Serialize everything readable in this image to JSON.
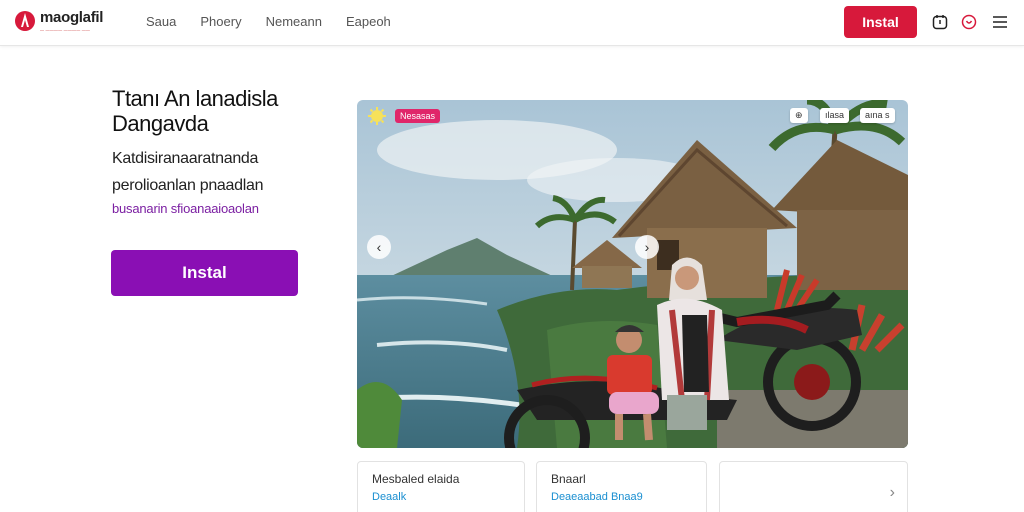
{
  "header": {
    "logo_text": "maoglafil",
    "logo_sub": "— ———— ———— ——",
    "nav": [
      "Saua",
      "Phoery",
      "Nemeann",
      "Eapeoh"
    ],
    "install_label": "Instal"
  },
  "hero": {
    "title": "Ttanı An lanadisla Dangavda",
    "body": "Katdisiranaaratnanda perolioanlan pnaadlan",
    "link": "busanarin sfioanaaioaolan",
    "cta_label": "Instal"
  },
  "carousel": {
    "tag": "Nesasas",
    "chips": [
      "⊕",
      "ılasa",
      "aına s"
    ],
    "prev": "‹",
    "next": "›"
  },
  "cards": [
    {
      "title": "Mesbaled elaida",
      "link": "Deaalk"
    },
    {
      "title": "Bnaarl",
      "link": "Deaeaabad Bnaa9"
    },
    {
      "title": "",
      "link": "",
      "chevron": "›"
    }
  ],
  "colors": {
    "brand_red": "#d7193b",
    "cta_purple": "#8a0fb4",
    "link_purple": "#7b1fa2",
    "link_blue": "#1a8fd1",
    "tag_pink": "#e0266a"
  },
  "icons": [
    "logo-icon",
    "app-icon",
    "heart-icon",
    "menu-icon",
    "sun-badge-icon",
    "chevron-left-icon",
    "chevron-right-icon"
  ]
}
